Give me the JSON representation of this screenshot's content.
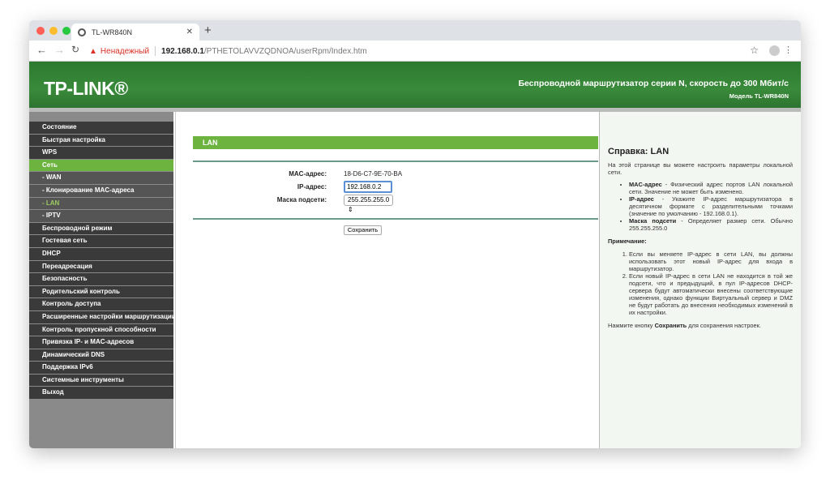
{
  "browser": {
    "tab_title": "TL-WR840N",
    "security": "Ненадежный",
    "url_host": "192.168.0.1",
    "url_path": "/PTHETOLAVVZQDNOA/userRpm/Index.htm"
  },
  "header": {
    "logo": "TP-LINK®",
    "title": "Беспроводной маршрутизатор серии N, скорость до 300 Мбит/с",
    "model": "Модель TL-WR840N"
  },
  "sidebar": {
    "items": [
      {
        "label": "Состояние",
        "type": "main"
      },
      {
        "label": "Быстрая настройка",
        "type": "main"
      },
      {
        "label": "WPS",
        "type": "main"
      },
      {
        "label": "Сеть",
        "type": "active"
      },
      {
        "label": "- WAN",
        "type": "sub"
      },
      {
        "label": "- Клонирование MAC-адреса",
        "type": "sub"
      },
      {
        "label": "- LAN",
        "type": "cur"
      },
      {
        "label": "- IPTV",
        "type": "sub"
      },
      {
        "label": "Беспроводной режим",
        "type": "main"
      },
      {
        "label": "Гостевая сеть",
        "type": "main"
      },
      {
        "label": "DHCP",
        "type": "main"
      },
      {
        "label": "Переадресация",
        "type": "main"
      },
      {
        "label": "Безопасность",
        "type": "main"
      },
      {
        "label": "Родительский контроль",
        "type": "main"
      },
      {
        "label": "Контроль доступа",
        "type": "main"
      },
      {
        "label": "Расширенные настройки маршрутизации",
        "type": "main"
      },
      {
        "label": "Контроль пропускной способности",
        "type": "main"
      },
      {
        "label": "Привязка IP- и MAC-адресов",
        "type": "main"
      },
      {
        "label": "Динамический DNS",
        "type": "main"
      },
      {
        "label": "Поддержка IPv6",
        "type": "main"
      },
      {
        "label": "Системные инструменты",
        "type": "main"
      },
      {
        "label": "Выход",
        "type": "main"
      }
    ]
  },
  "main": {
    "section": "LAN",
    "mac_label": "MAC-адрес:",
    "mac_value": "18-D6-C7-9E-70-BA",
    "ip_label": "IP-адрес:",
    "ip_value": "192.168.0.2",
    "mask_label": "Маска подсети:",
    "mask_value": "255.255.255.0",
    "save": "Сохранить"
  },
  "help": {
    "title": "Справка: LAN",
    "intro": "На этой странице вы можете настроить параметры локальной сети.",
    "bullets": [
      {
        "term": "MAC-адрес",
        "text": " - Физический адрес портов LAN локальной сети. Значение не может быть изменено."
      },
      {
        "term": "IP-адрес",
        "text": " - Укажите IP-адрес маршрутизатора в десятичном формате с разделительными точками (значение по умолчанию - 192.168.0.1)."
      },
      {
        "term": "Маска подсети",
        "text": " - Определяет размер сети. Обычно 255.255.255.0"
      }
    ],
    "note_title": "Примечание:",
    "notes": [
      "Если вы меняете IP-адрес в сети LAN, вы должны использовать этот новый IP-адрес для входа в маршрутизатор.",
      "Если новый IP-адрес в сети LAN не находится в той же подсети, что и предыдущий, в пул IP-адресов DHCP-сервера будут автоматически внесены соответствующие изменения, однако функции Виртуальный сервер и DMZ не будут работать до внесения необходимых изменений в их настройки."
    ],
    "footer_pre": "Нажмите кнопку ",
    "footer_bold": "Сохранить",
    "footer_post": " для сохранения настроек."
  }
}
